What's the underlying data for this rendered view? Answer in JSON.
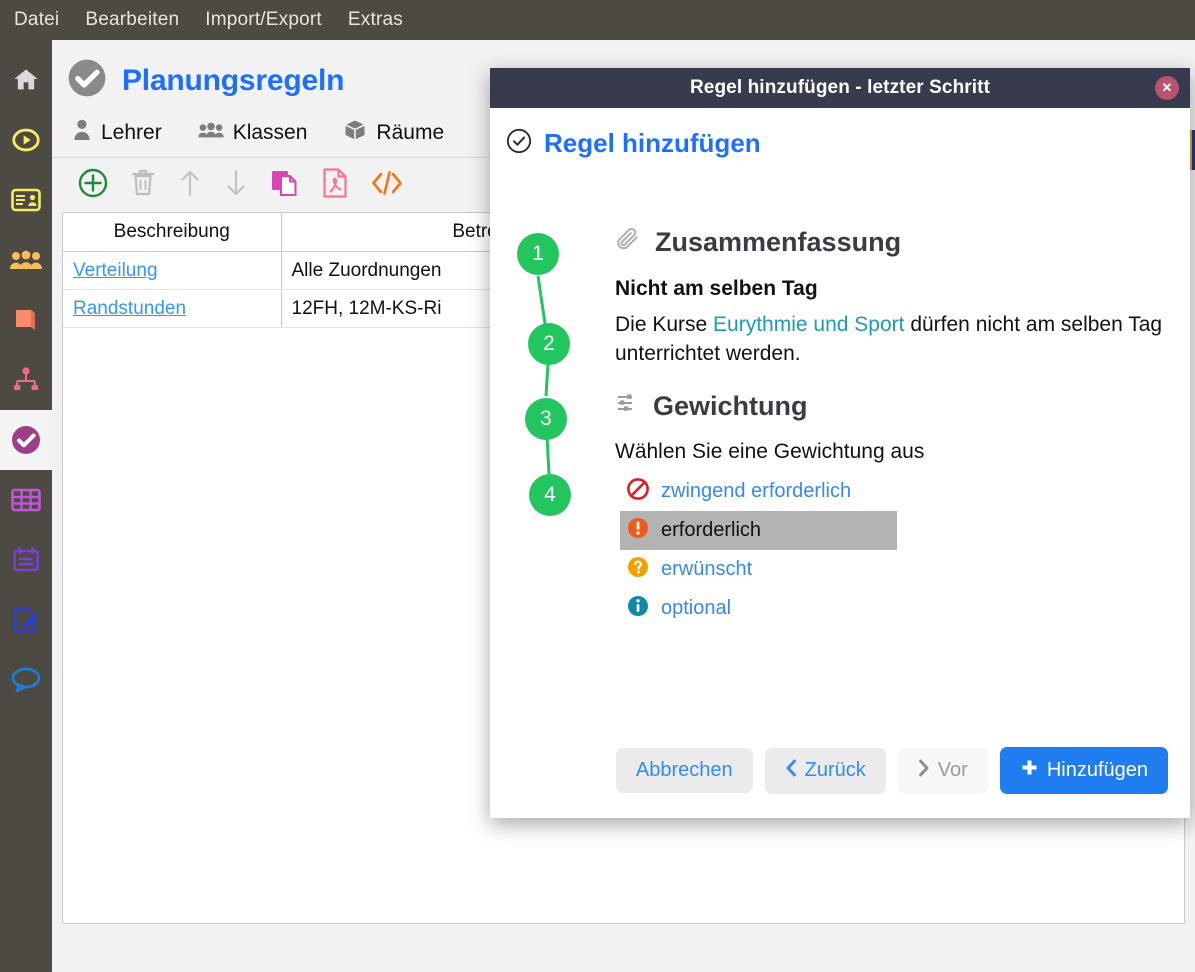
{
  "menubar": {
    "items": [
      {
        "label": "Datei"
      },
      {
        "label": "Bearbeiten"
      },
      {
        "label": "Import/Export"
      },
      {
        "label": "Extras"
      }
    ]
  },
  "sidebar": {
    "items": [
      {
        "name": "home",
        "icon": "home-icon",
        "color": "#d9d9d9"
      },
      {
        "name": "start",
        "icon": "play-circle-icon",
        "color": "#f5ec63"
      },
      {
        "name": "idcard",
        "icon": "id-card-icon",
        "color": "#f5ec63"
      },
      {
        "name": "classes",
        "icon": "people-icon",
        "color": "#f6bd5b"
      },
      {
        "name": "subjects",
        "icon": "book-icon",
        "color": "#f98a6a"
      },
      {
        "name": "structure",
        "icon": "sitemap-icon",
        "color": "#f06b8b"
      },
      {
        "name": "rules",
        "icon": "check-circle-icon",
        "color": "#9c3f86",
        "active": true
      },
      {
        "name": "timetable",
        "icon": "table-grid-icon",
        "color": "#c455d6"
      },
      {
        "name": "calendar",
        "icon": "calendar-icon",
        "color": "#7b3fd4"
      },
      {
        "name": "edit",
        "icon": "edit-doc-icon",
        "color": "#2e3fdc"
      },
      {
        "name": "messages",
        "icon": "chat-bubble-icon",
        "color": "#1b7fe0"
      }
    ]
  },
  "page": {
    "title": "Planungsregeln",
    "title_icon": "check-circle-icon",
    "tabs": [
      {
        "label": "Lehrer",
        "icon": "person-icon"
      },
      {
        "label": "Klassen",
        "icon": "group-icon"
      },
      {
        "label": "Räume",
        "icon": "cube-icon"
      }
    ],
    "toolbar": [
      {
        "name": "add-button",
        "icon": "plus-circle-icon",
        "color": "#1e8a3c",
        "enabled": true
      },
      {
        "name": "delete-button",
        "icon": "trash-icon",
        "color": "#bdbdbd",
        "enabled": false
      },
      {
        "name": "move-up-button",
        "icon": "arrow-up-icon",
        "color": "#c4c4c4",
        "enabled": false
      },
      {
        "name": "move-down-button",
        "icon": "arrow-down-icon",
        "color": "#c4c4c4",
        "enabled": false
      },
      {
        "name": "copy-button",
        "icon": "copy-icon",
        "color": "#d946b4",
        "enabled": true
      },
      {
        "name": "pdf-button",
        "icon": "pdf-file-icon",
        "color": "#f9748f",
        "enabled": true
      },
      {
        "name": "code-button",
        "icon": "code-icon",
        "color": "#f97316",
        "enabled": true
      }
    ]
  },
  "table": {
    "columns": [
      {
        "label": "Beschreibung"
      },
      {
        "label": "Betroffene"
      },
      {
        "label": ""
      }
    ],
    "rows": [
      {
        "beschreibung": "Verteilung",
        "betroffene": "Alle Zuordnungen",
        "rest": ""
      },
      {
        "beschreibung": "Randstunden",
        "betroffene": "12FH, 12M-KS-Ri",
        "rest": ""
      }
    ]
  },
  "dialog": {
    "window_title": "Regel hinzufügen - letzter Schritt",
    "close_label": "✕",
    "heading": "Regel hinzufügen",
    "heading_icon": "check-circle-icon",
    "steps": [
      "1",
      "2",
      "3",
      "4"
    ],
    "summary": {
      "title": "Zusammenfassung",
      "icon": "paperclip-icon",
      "rule_name": "Nicht am selben Tag",
      "desc_pre": "Die Kurse ",
      "desc_highlight": "Eurythmie und Sport",
      "desc_post": " dürfen nicht am selben Tag unterrichtet werden."
    },
    "weighting": {
      "title": "Gewichtung",
      "icon": "sliders-icon",
      "prompt": "Wählen Sie eine Gewichtung aus",
      "options": [
        {
          "label": "zwingend erforderlich",
          "icon": "forbidden-icon",
          "color": "#e01b24",
          "selected": false
        },
        {
          "label": "erforderlich",
          "icon": "exclamation-icon",
          "color": "#f05a1e",
          "selected": true
        },
        {
          "label": "erwünscht",
          "icon": "question-icon",
          "color": "#f5a000",
          "selected": false
        },
        {
          "label": "optional",
          "icon": "info-icon",
          "color": "#1086a8",
          "selected": false
        }
      ]
    },
    "buttons": [
      {
        "name": "cancel-button",
        "label": "Abbrechen",
        "style": "grey",
        "icon": ""
      },
      {
        "name": "back-button",
        "label": "Zurück",
        "style": "grey",
        "icon": "chevron-left-icon"
      },
      {
        "name": "next-button",
        "label": "Vor",
        "style": "faint",
        "icon": "chevron-right-icon"
      },
      {
        "name": "confirm-button",
        "label": "Hinzufügen",
        "style": "blue",
        "icon": "plus-icon"
      }
    ]
  },
  "colors": {
    "chrome": "#4d4a44",
    "accent_blue": "#1f6fff",
    "modal_header": "#373b4d",
    "step_green": "#22c55e",
    "selected_row": "#b3b3b3"
  }
}
